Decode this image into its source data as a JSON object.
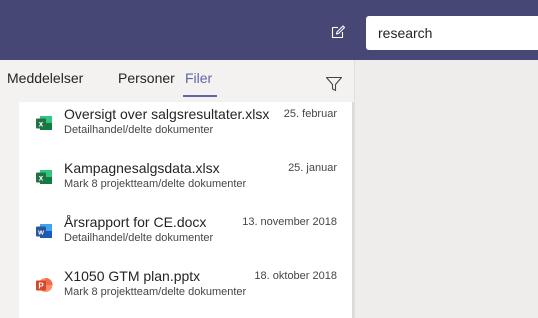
{
  "search": {
    "value": "research"
  },
  "tabs": [
    {
      "label": "Meddelelser"
    },
    {
      "label": "Personer"
    },
    {
      "label": "Filer"
    }
  ],
  "colors": {
    "topbar": "#464775",
    "accent": "#6264a7",
    "excel": "#217346",
    "word": "#2b579a",
    "powerpoint": "#d24726"
  },
  "files": [
    {
      "name": "Oversigt over salgsresultater.xlsx",
      "date": "25. februar",
      "location": "Detailhandel/delte dokumenter",
      "icon": "excel-icon"
    },
    {
      "name": "Kampagnesalgsdata.xlsx",
      "date": "25. januar",
      "location": "Mark 8 projektteam/delte dokumenter",
      "icon": "excel-icon"
    },
    {
      "name": "Årsrapport for CE.docx",
      "date": "13. november 2018",
      "location": "Detailhandel/delte dokumenter",
      "icon": "word-icon"
    },
    {
      "name": "X1050 GTM plan.pptx",
      "date": "18. oktober 2018",
      "location": "Mark 8 projektteam/delte dokumenter",
      "icon": "powerpoint-icon"
    }
  ]
}
